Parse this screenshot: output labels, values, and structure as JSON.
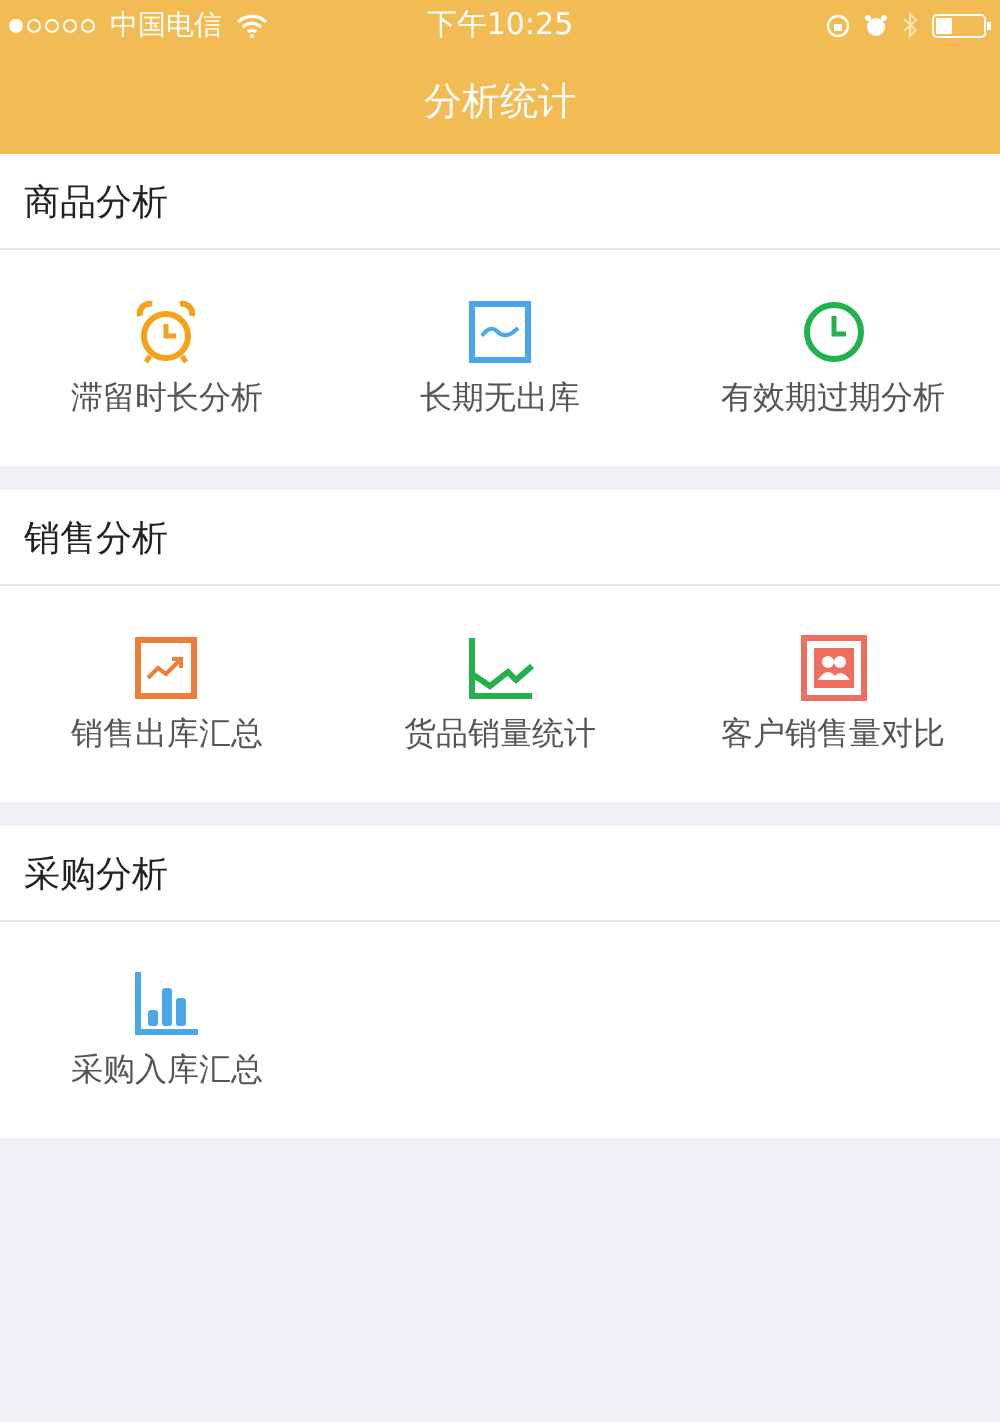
{
  "status_bar": {
    "carrier": "中国电信",
    "time": "下午10:25"
  },
  "nav_bar": {
    "title": "分析统计"
  },
  "sections": [
    {
      "title": "商品分析",
      "items": [
        {
          "label": "滞留时长分析",
          "kind": "alarm",
          "color": "#f3a21b"
        },
        {
          "label": "长期无出库",
          "kind": "wave",
          "color": "#4aa8ea"
        },
        {
          "label": "有效期过期分析",
          "kind": "clock",
          "color": "#22b14c"
        }
      ]
    },
    {
      "title": "销售分析",
      "items": [
        {
          "label": "销售出库汇总",
          "kind": "trend",
          "color": "#ef7d3a"
        },
        {
          "label": "货品销量统计",
          "kind": "line",
          "color": "#22b14c"
        },
        {
          "label": "客户销售量对比",
          "kind": "people",
          "color": "#ee6f5f"
        }
      ]
    },
    {
      "title": "采购分析",
      "items": [
        {
          "label": "采购入库汇总",
          "kind": "bars",
          "color": "#4aa8ea"
        }
      ]
    }
  ]
}
